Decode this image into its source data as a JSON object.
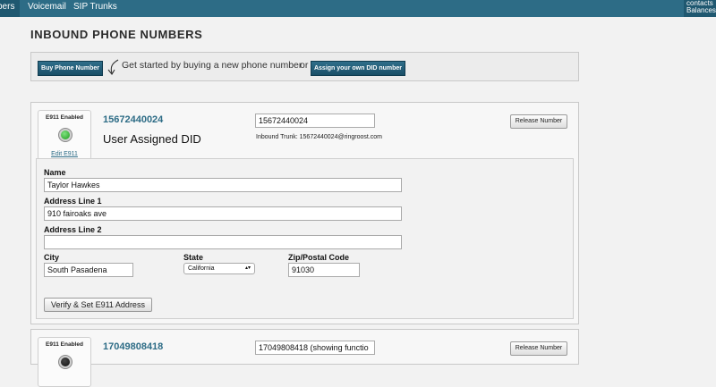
{
  "nav": {
    "tabs": [
      "bers",
      "Voicemail",
      "SIP Trunks"
    ],
    "right_lines": [
      "contacts",
      "Balances"
    ]
  },
  "page_title": "INBOUND PHONE NUMBERS",
  "actionbar": {
    "buy_label": "Buy Phone Number",
    "hint": "Get started by buying a new phone number",
    "or_text": "or",
    "assign_label": "Assign your own DID number"
  },
  "numbers": [
    {
      "e911_label": "E911 Enabled",
      "edit_label": "Edit E911",
      "number": "15672440024",
      "subtitle": "User Assigned DID",
      "input_value": "15672440024",
      "trunk": "Inbound Trunk: 15672440024@ringroost.com",
      "release_label": "Release Number",
      "form": {
        "name_label": "Name",
        "name_value": "Taylor Hawkes",
        "addr1_label": "Address Line 1",
        "addr1_value": "910 fairoaks ave",
        "addr2_label": "Address Line 2",
        "addr2_value": "",
        "city_label": "City",
        "city_value": "South Pasadena",
        "state_label": "State",
        "state_value": "California",
        "zip_label": "Zip/Postal Code",
        "zip_value": "91030",
        "verify_label": "Verify & Set E911 Address"
      }
    },
    {
      "e911_label": "E911 Enabled",
      "number": "17049808418",
      "input_value": "17049808418 (showing functio",
      "release_label": "Release Number"
    }
  ],
  "colors": {
    "nav": "#2d6c86",
    "accent_button": "#1f5870",
    "status_on": "#1c9a1c"
  }
}
